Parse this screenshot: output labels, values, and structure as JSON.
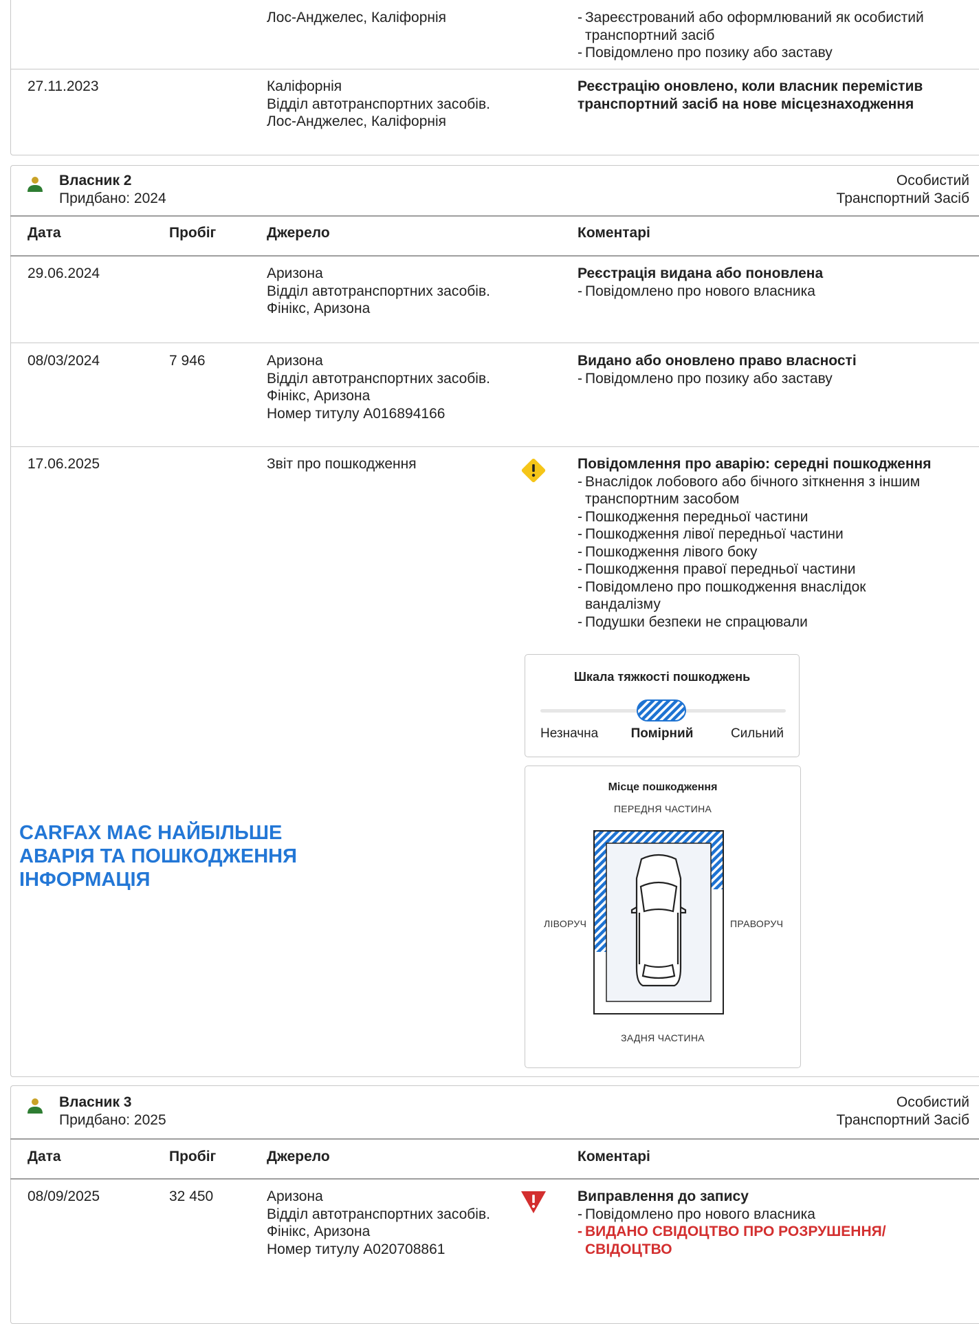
{
  "top_rows": [
    {
      "date": "",
      "mileage": "",
      "source": [
        "Лос-Анджелес, Каліфорнія"
      ],
      "comment_title": "",
      "comment_items": [
        "Зареєстрований або оформлюваний як особистий транспортний засіб",
        "Повідомлено про позику або заставу"
      ]
    },
    {
      "date": "27.11.2023",
      "mileage": "",
      "source": [
        "Каліфорнія",
        "Відділ автотранспортних засобів.",
        "Лос-Анджелес, Каліфорнія"
      ],
      "comment_title": "Реєстрацію оновлено, коли власник перемістив транспортний засіб на нове місцезнаходження",
      "comment_items": []
    }
  ],
  "table_headers": {
    "date": "Дата",
    "mileage": "Пробіг",
    "source": "Джерело",
    "comments": "Коментарі"
  },
  "owner2": {
    "title": "Власник 2",
    "purchased": "Придбано: 2024",
    "type_line1": "Особистий",
    "type_line2": "Транспортний Засіб",
    "rows": [
      {
        "date": "29.06.2024",
        "mileage": "",
        "source": [
          "Аризона",
          "Відділ автотранспортних засобів.",
          "Фінікс, Аризона"
        ],
        "comment_title": "Реєстрація видана або поновлена",
        "comment_items": [
          "Повідомлено про нового власника"
        ]
      },
      {
        "date": "08/03/2024",
        "mileage": "7 946",
        "source": [
          "Аризона",
          "Відділ автотранспортних засобів.",
          "Фінікс, Аризона",
          "Номер титулу A016894166"
        ],
        "comment_title": "Видано або оновлено право власності",
        "comment_items": [
          "Повідомлено про позику або заставу"
        ]
      },
      {
        "date": "17.06.2025",
        "mileage": "",
        "source": [
          "Звіт про пошкодження"
        ],
        "comment_title": "Повідомлення про аварію: середні пошкодження",
        "comment_items": [
          "Внаслідок лобового або бічного зіткнення з іншим транспортним засобом",
          "Пошкодження передньої частини",
          "Пошкодження лівої передньої частини",
          "Пошкодження лівого боку",
          "Пошкодження правої передньої частини",
          "Повідомлено про пошкодження внаслідок вандалізму",
          "Подушки безпеки не спрацювали"
        ]
      }
    ]
  },
  "severity": {
    "title": "Шкала тяжкості пошкоджень",
    "labels": [
      "Незначна",
      "Помірний",
      "Сильний"
    ],
    "selected": "Помірний"
  },
  "damage_location": {
    "title": "Місце пошкодження",
    "front": "ПЕРЕДНЯ ЧАСТИНА",
    "rear": "ЗАДНЯ ЧАСТИНА",
    "left": "ЛІВОРУЧ",
    "right": "ПРАВОРУЧ"
  },
  "promo": {
    "line1": "CARFAX МАЄ НАЙБІЛЬШЕ",
    "line2": "АВАРІЯ ТА ПОШКОДЖЕННЯ",
    "line3": "ІНФОРМАЦІЯ"
  },
  "owner3": {
    "title": "Власник 3",
    "purchased": "Придбано: 2025",
    "type_line1": "Особистий",
    "type_line2": "Транспортний Засіб",
    "rows": [
      {
        "date": "08/09/2025",
        "mileage": "32 450",
        "source": [
          "Аризона",
          "Відділ автотранспортних засобів.",
          "Фінікс, Аризона",
          "Номер титулу A020708861"
        ],
        "comment_title": "Виправлення до запису",
        "comment_items": [
          "Повідомлено про нового власника"
        ],
        "comment_alert": "ВИДАНО СВІДОЦТВО ПРО РОЗРУШЕННЯ/ СВІДОЦТВО"
      }
    ]
  },
  "colors": {
    "accent_blue": "#2377d6",
    "warning_yellow": "#f5c518",
    "alert_red": "#d32f2f",
    "owner_icon_green": "#2e7d32",
    "owner_icon_gold": "#c9a227"
  }
}
